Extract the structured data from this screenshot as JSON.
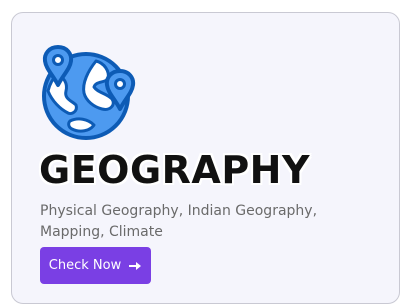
{
  "card": {
    "icon": "globe-with-location-pins-icon",
    "title": "GEOGRAPHY",
    "description": "Physical Geography, Indian Geography, Mapping, Climate",
    "button": {
      "label": "Check Now",
      "icon": "arrow-right-icon"
    }
  },
  "colors": {
    "card_background": "#f5f5fc",
    "card_border": "#c9c9d3",
    "icon_fill": "#4d9af0",
    "icon_outline": "#0d5bb5",
    "title": "#111111",
    "description": "#6a6a6a",
    "button_background": "#7a3fe4",
    "button_text": "#ffffff"
  }
}
